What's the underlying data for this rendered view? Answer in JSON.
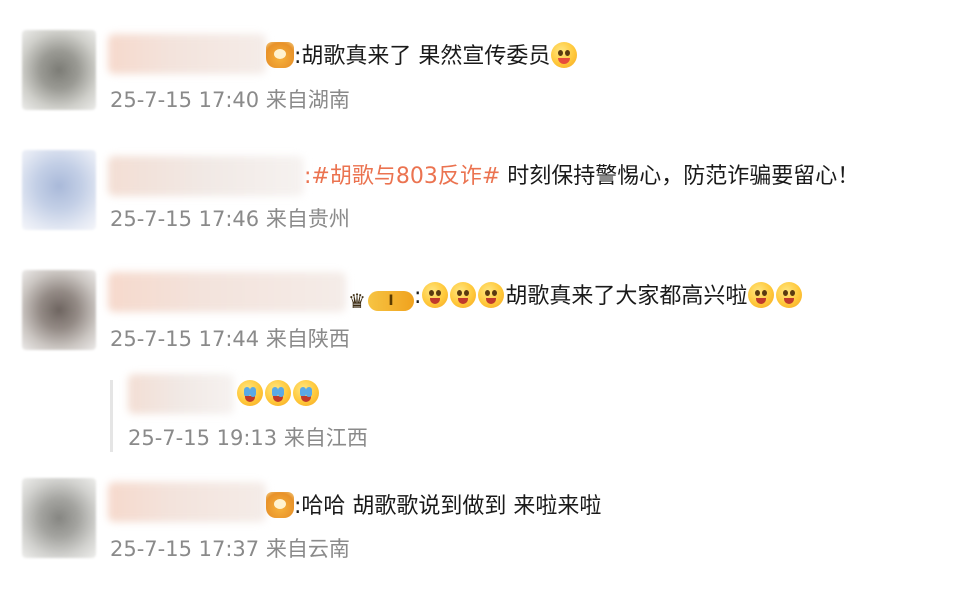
{
  "comments": [
    {
      "text": ":胡歌真来了 果然宣传委员",
      "meta": "25-7-15 17:40 来自湖南"
    },
    {
      "topic": ":#胡歌与803反诈#",
      "text": " 时刻保持警惕心，防范诈骗要留心！",
      "meta": "25-7-15 17:46 来自贵州"
    },
    {
      "level_badge": "I",
      "prefix": ":",
      "text": "胡歌真来了大家都高兴啦",
      "meta": "25-7-15 17:44 来自陕西"
    },
    {
      "text": ":哈哈  胡歌歌说到做到  来啦来啦",
      "meta": "25-7-15 17:37 来自云南"
    }
  ],
  "reply": {
    "meta": "25-7-15 19:13 来自江西"
  },
  "colors": {
    "topic": "#eb7350",
    "meta": "#8a8a8a",
    "text": "#1a1a1a"
  },
  "icons": [
    "crown-badge-icon",
    "heart-face-emoji",
    "smile-emoji",
    "cry-emoji",
    "level-badge-icon"
  ]
}
